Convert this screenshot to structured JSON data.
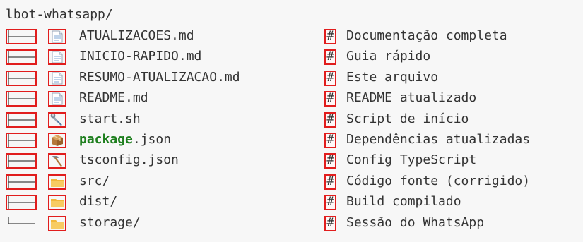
{
  "root_folder": "lbot-whatsapp/",
  "comment_marker": "#",
  "rows": [
    {
      "name": "ATUALIZACOES.md",
      "name_prefix": "",
      "name_rest": "",
      "icon": "document-icon",
      "comment": "Documentação completa",
      "last": false
    },
    {
      "name": "INICIO-RAPIDO.md",
      "name_prefix": "",
      "name_rest": "",
      "icon": "document-icon",
      "comment": "Guia rápido",
      "last": false
    },
    {
      "name": "RESUMO-ATUALIZACAO.md",
      "name_prefix": "",
      "name_rest": "",
      "icon": "document-icon",
      "comment": "Este arquivo",
      "last": false
    },
    {
      "name": "README.md",
      "name_prefix": "",
      "name_rest": "",
      "icon": "document-icon",
      "comment": "README atualizado",
      "last": false
    },
    {
      "name": "start.sh",
      "name_prefix": "",
      "name_rest": "",
      "icon": "wrench-icon",
      "comment": "Script de início",
      "last": false
    },
    {
      "name": "",
      "name_prefix": "package",
      "name_rest": ".json",
      "icon": "package-icon",
      "comment": "Dependências atualizadas",
      "last": false
    },
    {
      "name": "tsconfig.json",
      "name_prefix": "",
      "name_rest": "",
      "icon": "hammer-icon",
      "comment": "Config TypeScript",
      "last": false
    },
    {
      "name": "src/",
      "name_prefix": "",
      "name_rest": "",
      "icon": "folder-icon",
      "comment": "Código fonte (corrigido)",
      "last": false
    },
    {
      "name": "dist/",
      "name_prefix": "",
      "name_rest": "",
      "icon": "folder-icon",
      "comment": "Build compilado",
      "last": false
    },
    {
      "name": "storage/",
      "name_prefix": "",
      "name_rest": "",
      "icon": "folder-icon",
      "comment": "Sessão do WhatsApp",
      "last": true
    }
  ],
  "colors": {
    "highlight_border": "#e11d1d",
    "package_green": "#1e7f1e",
    "text": "#333333",
    "background": "#f7f7f7"
  }
}
